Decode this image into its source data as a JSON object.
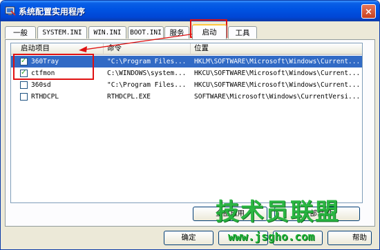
{
  "window": {
    "title": "系统配置实用程序",
    "close_label": "×"
  },
  "tabs": [
    {
      "label": "一般",
      "active": false
    },
    {
      "label": "SYSTEM.INI",
      "active": false
    },
    {
      "label": "WIN.INI",
      "active": false
    },
    {
      "label": "BOOT.INI",
      "active": false
    },
    {
      "label": "服务",
      "active": false
    },
    {
      "label": "启动",
      "active": true
    },
    {
      "label": "工具",
      "active": false
    }
  ],
  "list": {
    "columns": [
      "启动项目",
      "命令",
      "位置"
    ],
    "rows": [
      {
        "checked": true,
        "selected": true,
        "name": "360Tray",
        "command": "\"C:\\Program Files...",
        "location": "HKLM\\SOFTWARE\\Microsoft\\Windows\\Current..."
      },
      {
        "checked": true,
        "selected": false,
        "name": "ctfmon",
        "command": "C:\\WINDOWS\\system...",
        "location": "HKCU\\SOFTWARE\\Microsoft\\Windows\\Current..."
      },
      {
        "checked": false,
        "selected": false,
        "name": "360sd",
        "command": "\"C:\\Program Files...",
        "location": "HKCU\\SOFTWARE\\Microsoft\\Windows\\Current..."
      },
      {
        "checked": false,
        "selected": false,
        "name": "RTHDCPL",
        "command": "RTHDCPL.EXE",
        "location": "SOFTWARE\\Microsoft\\Windows\\CurrentVersi..."
      }
    ]
  },
  "buttons": {
    "enable_all": "全部启用",
    "disable_all": "全部禁用",
    "ok": "确定",
    "help": "帮助"
  },
  "watermark": {
    "text": "技术员联盟",
    "url": "www.jsgho.com"
  },
  "colors": {
    "selection": "#316ac5",
    "annotation": "#e01010",
    "watermark": "#21b33a"
  }
}
